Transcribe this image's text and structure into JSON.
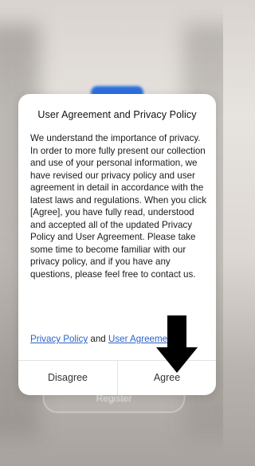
{
  "background": {
    "register_label": "Register"
  },
  "dialog": {
    "title": "User Agreement and Privacy Policy",
    "body": "We understand the importance of privacy. In order to more fully present our collection and use of your personal information, we have revised our privacy policy and user agreement in detail in accordance with the latest laws and regulations. When you click [Agree], you have fully read, understood and accepted all of the updated Privacy Policy and User Agreement. Please take some time to become familiar with our privacy policy, and if you have any questions, please feel free to contact us.",
    "privacy_policy_link": "Privacy Policy",
    "and_text": "and",
    "user_agreement_link": "User Agreement",
    "disagree_label": "Disagree",
    "agree_label": "Agree"
  },
  "annotation": {
    "arrow_icon": "down-arrow-icon",
    "arrow_color": "#000000"
  }
}
